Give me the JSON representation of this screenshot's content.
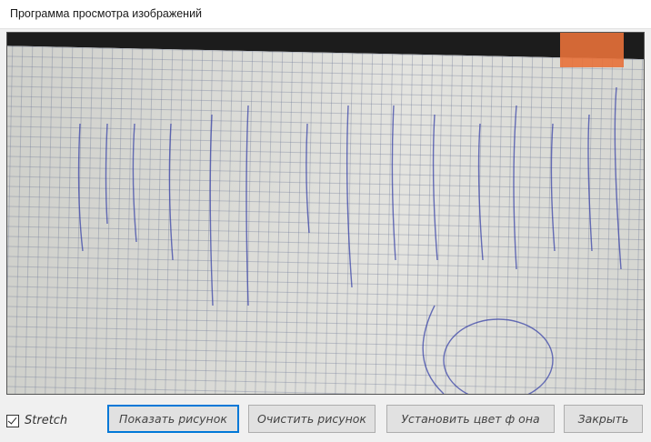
{
  "window": {
    "title": "Программа просмотра изображений"
  },
  "picture": {
    "description_icon": "image-photo",
    "stretch": true
  },
  "controls": {
    "stretch_label": "Stretch",
    "stretch_checked": true,
    "buttons": [
      {
        "label": "Показать рисунок",
        "focused": true
      },
      {
        "label": "Очистить рисунок"
      },
      {
        "label": "Установить цвет ф она"
      },
      {
        "label": "Закрыть"
      }
    ]
  },
  "colors": {
    "focus": "#0078d7",
    "button_bg": "#e1e1e1",
    "window_bg": "#f0f0f0"
  }
}
